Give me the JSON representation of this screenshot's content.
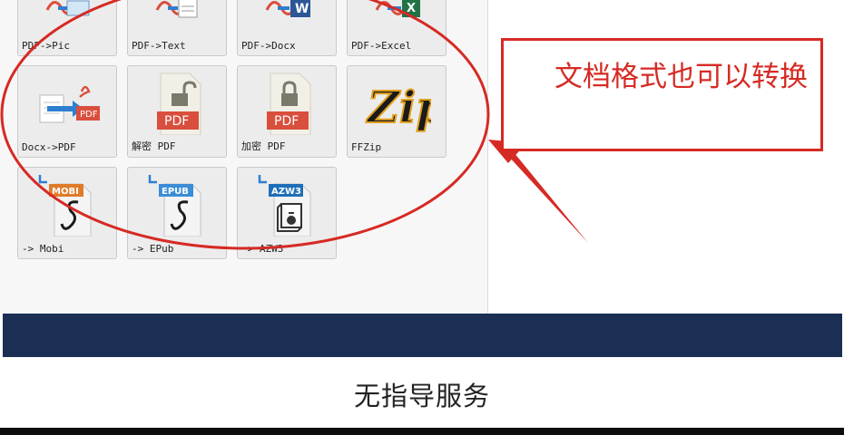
{
  "tiles": [
    {
      "label": "PDF->Pic",
      "icon": "pdf-to-pic-icon"
    },
    {
      "label": "PDF->Text",
      "icon": "pdf-to-text-icon"
    },
    {
      "label": "PDF->Docx",
      "icon": "pdf-to-word-icon"
    },
    {
      "label": "PDF->Excel",
      "icon": "pdf-to-excel-icon"
    },
    {
      "label": "Docx->PDF",
      "icon": "word-to-pdf-icon",
      "badge": "PDF"
    },
    {
      "label": "解密 PDF",
      "icon": "unlock-pdf-icon",
      "badge": "PDF"
    },
    {
      "label": "加密 PDF",
      "icon": "lock-pdf-icon",
      "badge": "PDF"
    },
    {
      "label": "FFZip",
      "icon": "ffzip-logo-icon",
      "logo_text": "Zip"
    },
    {
      "label": "-> Mobi",
      "icon": "mobi-convert-icon",
      "badge": "MOBI"
    },
    {
      "label": "-> EPub",
      "icon": "epub-convert-icon",
      "badge": "EPUB"
    },
    {
      "label": "-> AZW3",
      "icon": "azw3-convert-icon",
      "badge": "AZW3"
    }
  ],
  "callout": {
    "text": "文档格式也可以转换"
  },
  "caption": "无指导服务",
  "colors": {
    "accent_red": "#d62a24",
    "banner_navy": "#1b2f55",
    "pdf_red": "#d94f3d",
    "word_blue": "#2b5797",
    "excel_green": "#217346"
  }
}
